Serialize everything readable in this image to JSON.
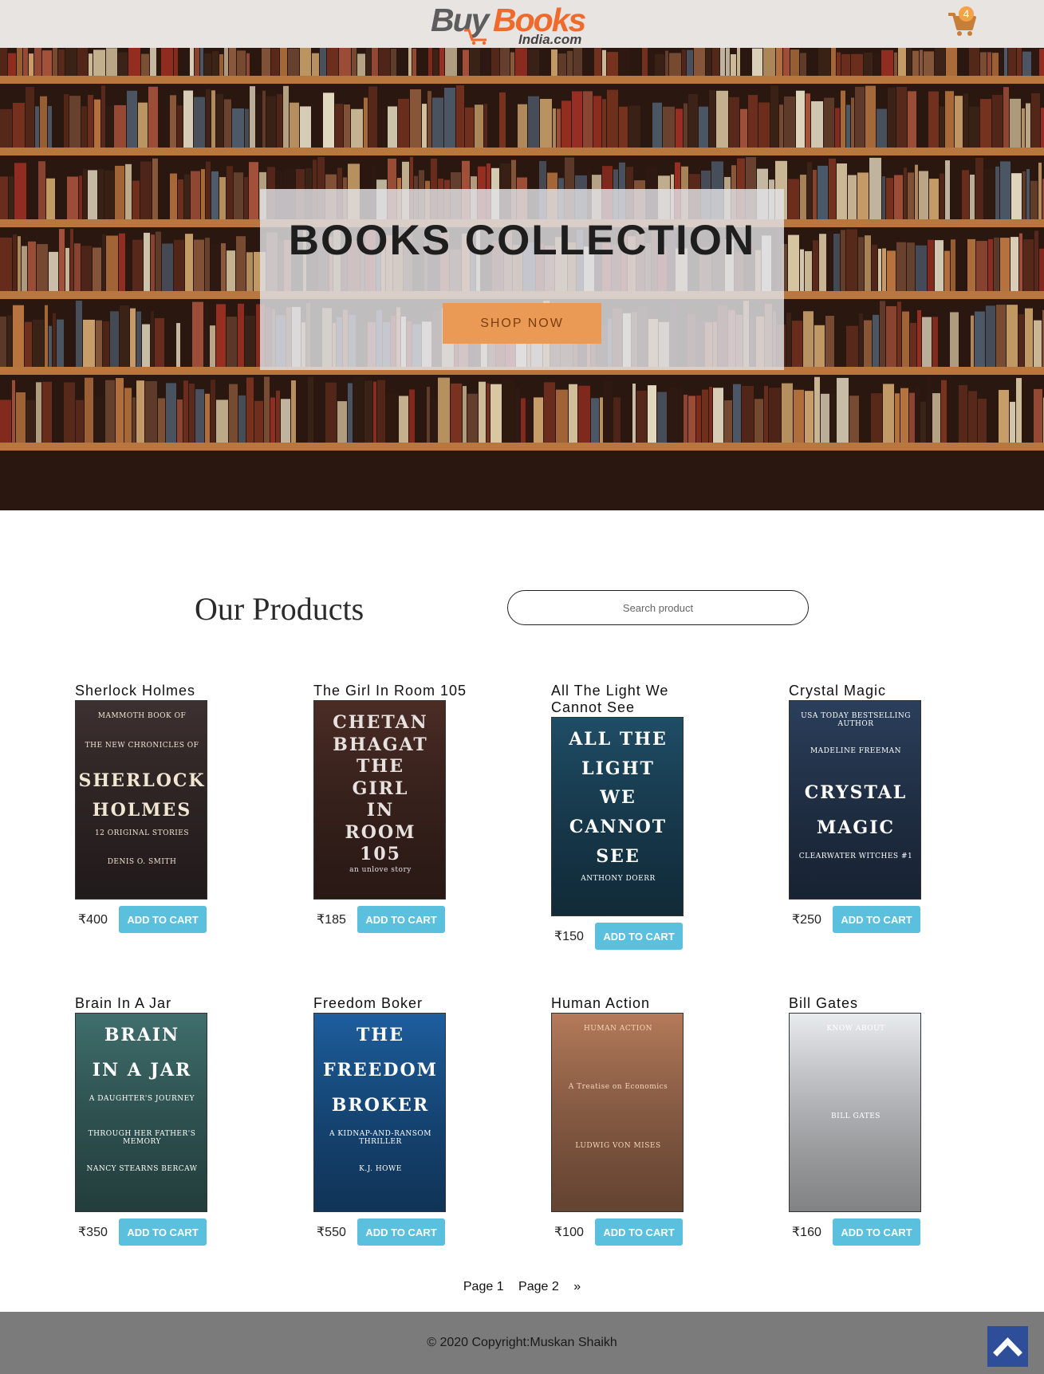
{
  "header": {
    "logo_buy": "Buy",
    "logo_books": "Books",
    "logo_india": "India.com",
    "cart_count": "4"
  },
  "hero": {
    "title": "BOOKS COLLECTION",
    "shop_button": "SHOP NOW"
  },
  "products_section": {
    "title": "Our Products",
    "search_placeholder": "Search product"
  },
  "products": [
    {
      "title": "Sherlock Holmes",
      "price": "₹400",
      "button": "ADD TO CART",
      "cover": {
        "bg": "#3d3030",
        "lines": [
          "MAMMOTH BOOK OF",
          "THE NEW CHRONICLES OF",
          "SHERLOCK",
          "HOLMES",
          "12 ORIGINAL STORIES",
          "DENIS O. SMITH"
        ],
        "fg": "#f0e6d2"
      }
    },
    {
      "title": "The Girl In Room 105",
      "price": "₹185",
      "button": "ADD TO CART",
      "cover": {
        "bg": "#4a2c25",
        "lines": [
          "CHETAN",
          "BHAGAT",
          "THE",
          "GIRL",
          "IN",
          "ROOM",
          "105",
          "an unlove story"
        ],
        "fg": "#e7e1df"
      }
    },
    {
      "title": "All The Light We Cannot See",
      "price": "₹150",
      "button": "ADD TO CART",
      "cover": {
        "bg": "#1f4d66",
        "lines": [
          "ALL THE",
          "LIGHT",
          "WE",
          "CANNOT",
          "SEE",
          "ANTHONY DOERR"
        ],
        "fg": "#ffffff"
      }
    },
    {
      "title": "Crystal Magic",
      "price": "₹250",
      "button": "ADD TO CART",
      "cover": {
        "bg": "#2b3f5c",
        "lines": [
          "USA TODAY BESTSELLING AUTHOR",
          "MADELINE FREEMAN",
          "CRYSTAL",
          "MAGIC",
          "CLEARWATER WITCHES #1"
        ],
        "fg": "#ffffff"
      }
    },
    {
      "title": "Brain In A Jar",
      "price": "₹350",
      "button": "ADD TO CART",
      "cover": {
        "bg": "#3f6f6d",
        "lines": [
          "BRAIN",
          "IN A JAR",
          "A DAUGHTER'S JOURNEY",
          "THROUGH HER FATHER'S MEMORY",
          "NANCY STEARNS BERCAW"
        ],
        "fg": "#ffffff"
      }
    },
    {
      "title": "Freedom Boker",
      "price": "₹550",
      "button": "ADD TO CART",
      "cover": {
        "bg": "#1d5e9e",
        "lines": [
          "THE",
          "FREEDOM",
          "BROKER",
          "A KIDNAP-AND-RANSOM THRILLER",
          "K.J. HOWE"
        ],
        "fg": "#ffffff"
      }
    },
    {
      "title": "Human Action",
      "price": "₹100",
      "button": "ADD TO CART",
      "cover": {
        "bg": "#b47a5a",
        "lines": [
          "HUMAN ACTION",
          "A Treatise on Economics",
          "LUDWIG VON MISES"
        ],
        "fg": "#f4d6b8"
      }
    },
    {
      "title": "Bill Gates",
      "price": "₹160",
      "button": "ADD TO CART",
      "cover": {
        "bg": "#e9ecef",
        "lines": [
          "KNOW ABOUT",
          "BILL GATES"
        ],
        "fg": "#ffffff"
      }
    }
  ],
  "pagination": {
    "page1": "Page 1",
    "page2": "Page 2",
    "next": "»"
  },
  "footer": {
    "copyright": "© 2020 Copyright:Muskan Shaikh"
  },
  "colors": {
    "header_bg": "#e8e4e1",
    "accent_orange": "#ea9a55",
    "button_blue": "#5bc0de",
    "footer_bg": "#7b7b7b",
    "to_top_bg": "#2f4e9a"
  }
}
